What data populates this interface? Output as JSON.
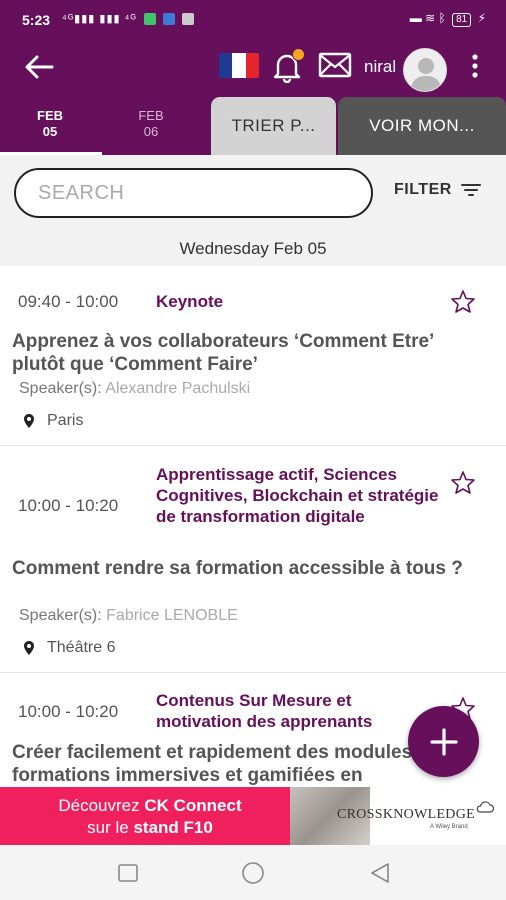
{
  "status_bar": {
    "time": "5:23",
    "battery": "81"
  },
  "header": {
    "user_name": "niral",
    "flag_colors": [
      "#1f3a93",
      "#ffffff",
      "#e3262e"
    ],
    "icons": [
      "back-arrow-icon",
      "french-flag-icon",
      "bell-icon",
      "mail-icon",
      "avatar",
      "more-vert-icon"
    ]
  },
  "tabs": {
    "dates": [
      {
        "month": "FEB",
        "day": "05",
        "active": true
      },
      {
        "month": "FEB",
        "day": "06",
        "active": false
      }
    ],
    "sort_label": "TRIER P...",
    "view_label": "VOIR MON..."
  },
  "search": {
    "placeholder": "SEARCH",
    "filter_label": "FILTER"
  },
  "day_header": "Wednesday Feb 05",
  "sessions": [
    {
      "time": "09:40 - 10:00",
      "track": "Keynote",
      "title": "Apprenez à vos collaborateurs ‘Comment Etre’ plutôt que ‘Comment Faire’",
      "speaker_label": "Speaker(s):",
      "speaker": "Alexandre Pachulski",
      "location": "Paris"
    },
    {
      "time": "10:00 - 10:20",
      "track": "Apprentissage actif, Sciences Cognitives, Blockchain et stratégie de transformation digitale",
      "title": "Comment rendre sa formation accessible à tous ?",
      "speaker_label": "Speaker(s):",
      "speaker": "Fabrice LENOBLE",
      "location": "Théâtre 6"
    },
    {
      "time": "10:00 - 10:20",
      "track": "Contenus Sur Mesure et motivation des apprenants",
      "title": "Créer facilement et rapidement des modules de formations immersives et gamifiées en",
      "speaker_label": "",
      "speaker": "",
      "location": ""
    }
  ],
  "banner": {
    "line1_prefix": "Découvrez ",
    "line1_bold": "CK Connect",
    "line2_prefix": "sur le ",
    "line2_bold": "stand F10",
    "brand": "CROSSKNOWLEDGE",
    "brand_sub": "A Wiley Brand"
  },
  "colors": {
    "primary": "#660f5b",
    "accent_dot": "#f5a623",
    "banner_pink": "#f0205f"
  }
}
